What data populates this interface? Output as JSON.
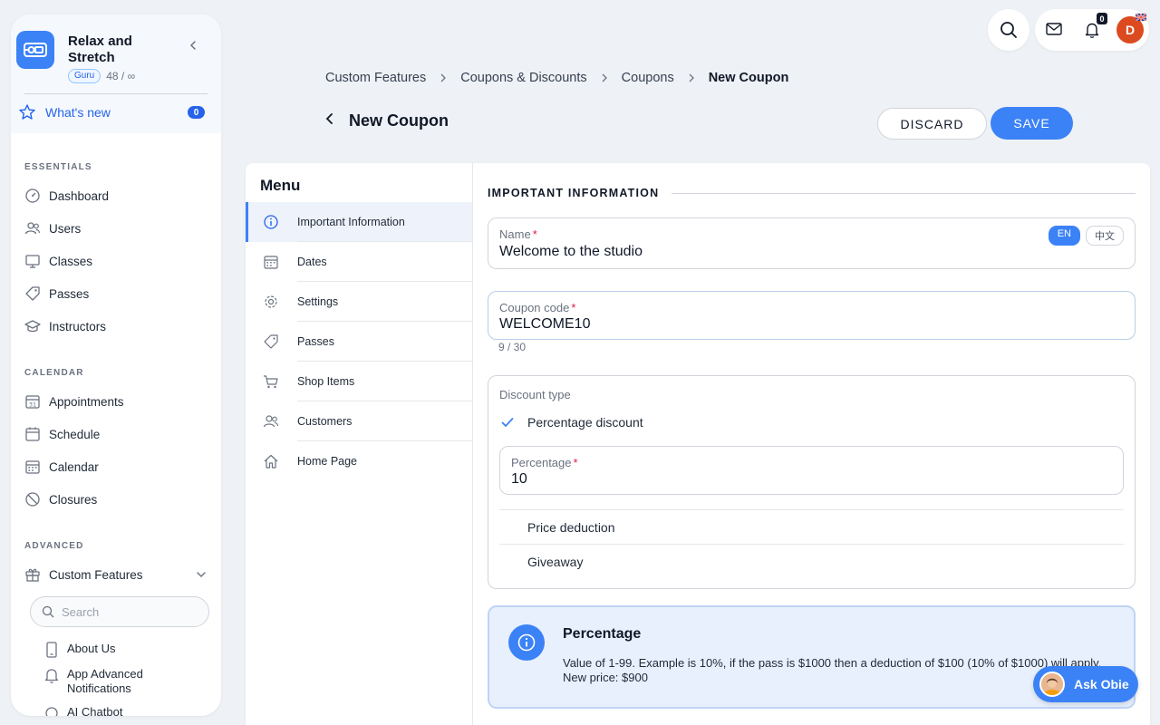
{
  "sidebar": {
    "brand_name": "Relax and Stretch",
    "plan_badge": "Guru",
    "usage": "48 / ∞",
    "whats_new": {
      "label": "What's new",
      "count": "0"
    },
    "sections": {
      "essentials": "ESSENTIALS",
      "calendar": "CALENDAR",
      "advanced": "ADVANCED"
    },
    "essentials_items": [
      {
        "label": "Dashboard",
        "icon": "dashboard-icon"
      },
      {
        "label": "Users",
        "icon": "users-icon"
      },
      {
        "label": "Classes",
        "icon": "classes-icon"
      },
      {
        "label": "Passes",
        "icon": "tag-icon"
      },
      {
        "label": "Instructors",
        "icon": "graduation-cap-icon"
      }
    ],
    "calendar_items": [
      {
        "label": "Appointments",
        "icon": "calendar-31-icon"
      },
      {
        "label": "Schedule",
        "icon": "calendar-icon"
      },
      {
        "label": "Calendar",
        "icon": "calendar-grid-icon"
      },
      {
        "label": "Closures",
        "icon": "ban-icon"
      }
    ],
    "advanced_items": [
      {
        "label": "Custom Features",
        "icon": "gift-icon"
      }
    ],
    "search_placeholder": "Search",
    "sub_items": [
      {
        "label": "About Us",
        "icon": "phone-icon"
      },
      {
        "label": "App Advanced Notifications",
        "icon": "bell-icon"
      },
      {
        "label": "AI Chatbot",
        "icon": "chat-icon"
      }
    ]
  },
  "topbar": {
    "notification_count": "0",
    "avatar_initial": "D"
  },
  "breadcrumb": [
    "Custom Features",
    "Coupons & Discounts",
    "Coupons",
    "New Coupon"
  ],
  "page": {
    "title": "New Coupon",
    "discard_label": "DISCARD",
    "save_label": "SAVE"
  },
  "menu": {
    "title": "Menu",
    "items": [
      {
        "label": "Important Information",
        "icon": "info-icon",
        "active": true
      },
      {
        "label": "Dates",
        "icon": "calendar-icon"
      },
      {
        "label": "Settings",
        "icon": "gear-icon"
      },
      {
        "label": "Passes",
        "icon": "tag-icon"
      },
      {
        "label": "Shop Items",
        "icon": "cart-icon"
      },
      {
        "label": "Customers",
        "icon": "users-icon"
      },
      {
        "label": "Home Page",
        "icon": "home-icon"
      }
    ]
  },
  "form": {
    "section_title": "IMPORTANT INFORMATION",
    "name": {
      "label": "Name",
      "value": "Welcome to the studio",
      "lang_en": "EN",
      "lang_zh": "中文"
    },
    "coupon_code": {
      "label": "Coupon code",
      "value": "WELCOME10",
      "counter": "9 / 30"
    },
    "discount_type": {
      "label": "Discount type",
      "options": [
        "Percentage discount",
        "Price deduction",
        "Giveaway"
      ],
      "selected": "Percentage discount",
      "percentage": {
        "label": "Percentage",
        "value": "10"
      }
    },
    "info": {
      "title": "Percentage",
      "text": "Value of 1-99. Example is 10%, if the pass is $1000 then a deduction of $100 (10% of $1000) will apply. New price: $900"
    }
  },
  "ask_obie": {
    "label": "Ask Obie"
  },
  "colors": {
    "accent": "#3b82f6",
    "avatar_bg": "#dc4a1f",
    "required": "#e11d48",
    "background": "#eef1f5"
  }
}
